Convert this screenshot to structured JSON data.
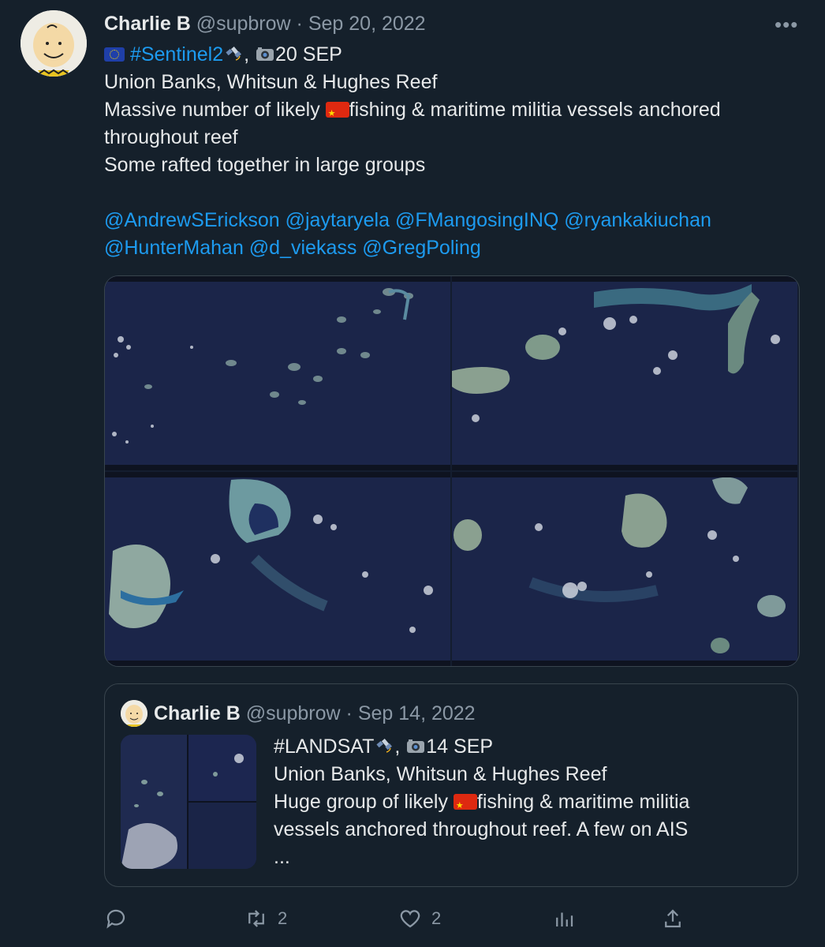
{
  "tweet": {
    "author_name": "Charlie B",
    "author_handle": "@supbrow",
    "separator": "·",
    "date": "Sep 20, 2022",
    "more_label": "•••",
    "line1_hashtag": "#Sentinel2",
    "line1_date": "20 SEP",
    "line2": "Union Banks, Whitsun & Hughes Reef",
    "line3_pre": "Massive number of likely ",
    "line3_post": "fishing & maritime militia vessels anchored",
    "line4": "throughout reef",
    "line5": "Some rafted together in large groups",
    "mentions_line1": "@AndrewSErickson @jaytaryela @FMangosingINQ @ryankakiuchan",
    "mentions_line2": "@HunterMahan @d_viekass @GregPoling"
  },
  "quoted_tweet": {
    "author_name": "Charlie B",
    "author_handle": "@supbrow",
    "separator": "·",
    "date": "Sep 14, 2022",
    "line1_hashtag": "#LANDSAT",
    "line1_date": "14 SEP",
    "line2": "Union Banks, Whitsun & Hughes Reef",
    "line3_pre": "Huge group of likely ",
    "line3_post": "fishing & maritime militia",
    "line4": "vessels anchored throughout reef.  A few on AIS",
    "line5": "..."
  },
  "actions": {
    "reply_count": "",
    "retweet_count": "2",
    "like_count": "2",
    "views_count": ""
  },
  "icons": [
    "reply-icon",
    "retweet-icon",
    "like-icon",
    "views-icon",
    "share-icon",
    "satellite-icon",
    "camera-icon",
    "eu-flag-icon",
    "china-flag-icon",
    "more-icon"
  ],
  "colors": {
    "background": "#15202b",
    "text": "#e7e9ea",
    "muted": "#8b98a5",
    "link": "#1d9bf0",
    "border": "#38444d"
  }
}
